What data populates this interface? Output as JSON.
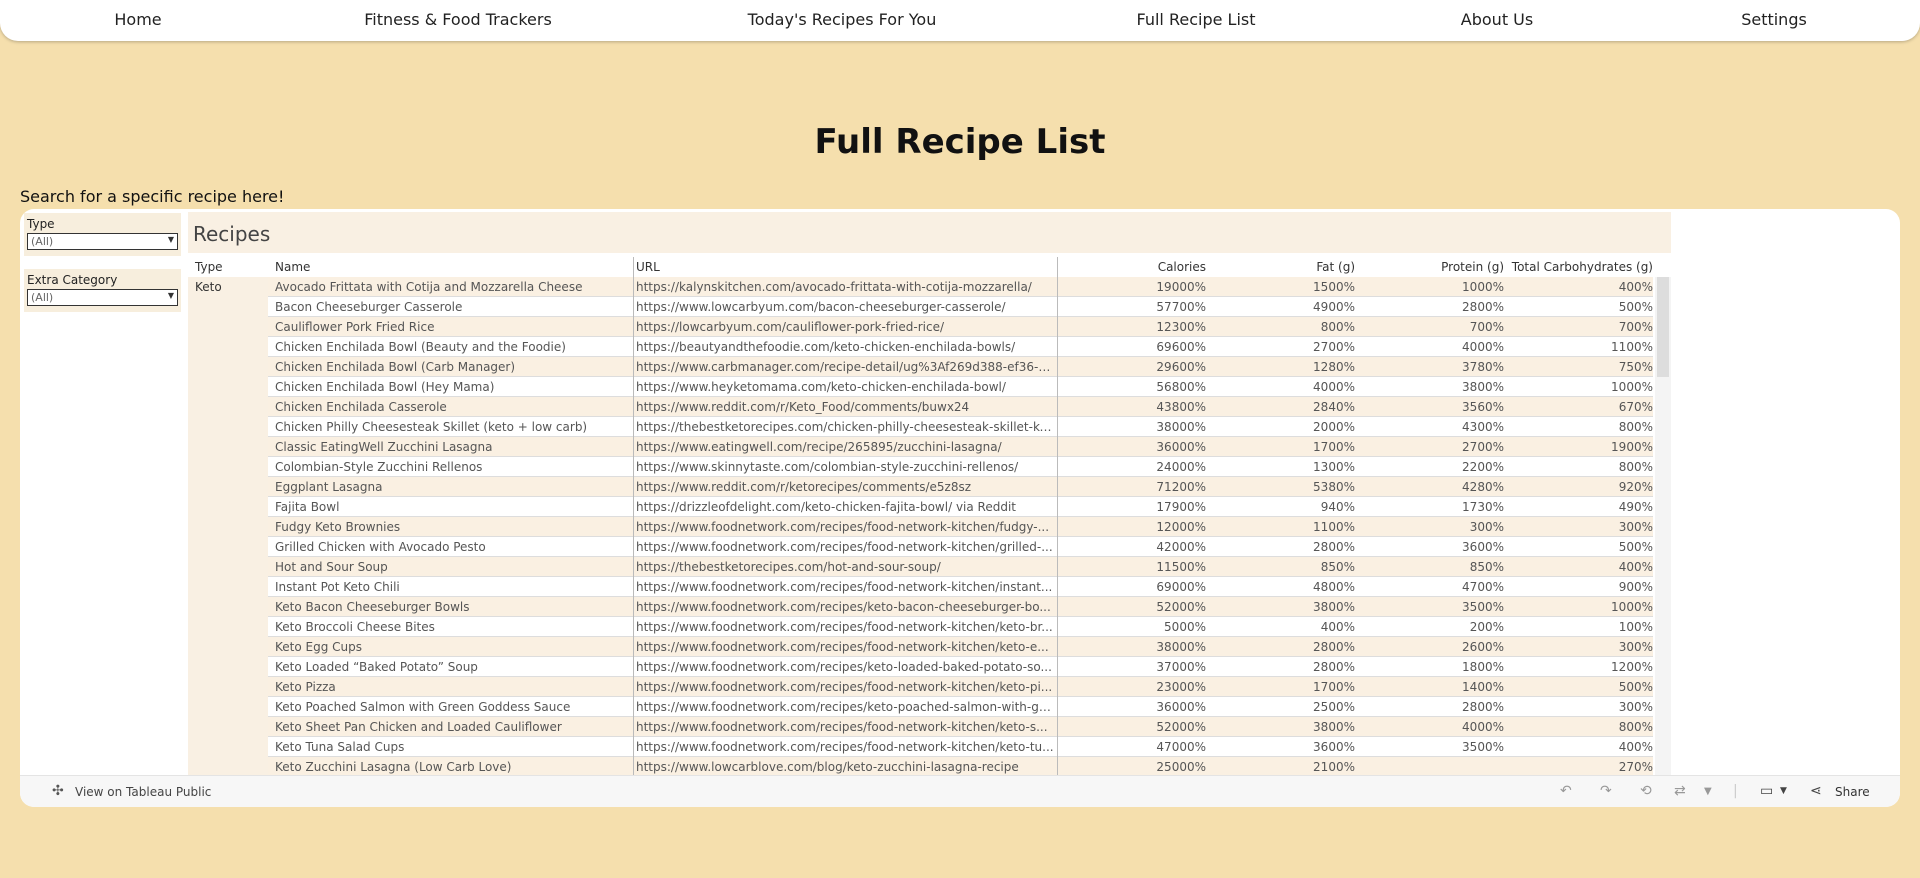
{
  "nav": {
    "items": [
      "Home",
      "Fitness & Food Trackers",
      "Today's Recipes For You",
      "Full Recipe List",
      "About Us",
      "Settings"
    ]
  },
  "page": {
    "title": "Full Recipe List",
    "search_hint": "Search for a specific recipe here!"
  },
  "filters": [
    {
      "label": "Type",
      "value": "(All)"
    },
    {
      "label": "Extra Category",
      "value": "(All)"
    }
  ],
  "sheet": {
    "title": "Recipes",
    "columns": [
      "Type",
      "Name",
      "URL",
      "Calories",
      "Fat (g)",
      "Protein (g)",
      "Total Carbohydrates (g)"
    ],
    "type_value": "Keto",
    "rows": [
      [
        "Avocado Frittata with Cotija and Mozzarella Cheese",
        "https://kalynskitchen.com/avocado-frittata-with-cotija-mozzarella/",
        "19000%",
        "1500%",
        "1000%",
        "400%"
      ],
      [
        "Bacon Cheeseburger Casserole",
        "https://www.lowcarbyum.com/bacon-cheeseburger-casserole/",
        "57700%",
        "4900%",
        "2800%",
        "500%"
      ],
      [
        "Cauliflower Pork Fried Rice",
        "https://lowcarbyum.com/cauliflower-pork-fried-rice/",
        "12300%",
        "800%",
        "700%",
        "700%"
      ],
      [
        "Chicken Enchilada Bowl (Beauty and the Foodie)",
        "https://beautyandthefoodie.com/keto-chicken-enchilada-bowls/",
        "69600%",
        "2700%",
        "4000%",
        "1100%"
      ],
      [
        "Chicken Enchilada Bowl (Carb Manager)",
        "https://www.carbmanager.com/recipe-detail/ug%3Af269d388-ef36-0...",
        "29600%",
        "1280%",
        "3780%",
        "750%"
      ],
      [
        "Chicken Enchilada Bowl (Hey Mama)",
        "https://www.heyketomama.com/keto-chicken-enchilada-bowl/",
        "56800%",
        "4000%",
        "3800%",
        "1000%"
      ],
      [
        "Chicken Enchilada Casserole",
        "https://www.reddit.com/r/Keto_Food/comments/buwx24",
        "43800%",
        "2840%",
        "3560%",
        "670%"
      ],
      [
        "Chicken Philly Cheesesteak Skillet (keto + low carb)",
        "https://thebestketorecipes.com/chicken-philly-cheesesteak-skillet-ke...",
        "38000%",
        "2000%",
        "4300%",
        "800%"
      ],
      [
        "Classic EatingWell Zucchini Lasagna",
        "https://www.eatingwell.com/recipe/265895/zucchini-lasagna/",
        "36000%",
        "1700%",
        "2700%",
        "1900%"
      ],
      [
        "Colombian-Style Zucchini Rellenos",
        "https://www.skinnytaste.com/colombian-style-zucchini-rellenos/",
        "24000%",
        "1300%",
        "2200%",
        "800%"
      ],
      [
        "Eggplant Lasagna",
        "https://www.reddit.com/r/ketorecipes/comments/e5z8sz",
        "71200%",
        "5380%",
        "4280%",
        "920%"
      ],
      [
        "Fajita Bowl",
        "https://drizzleofdelight.com/keto-chicken-fajita-bowl/ via Reddit",
        "17900%",
        "940%",
        "1730%",
        "490%"
      ],
      [
        "Fudgy Keto Brownies",
        "https://www.foodnetwork.com/recipes/food-network-kitchen/fudgy-...",
        "12000%",
        "1100%",
        "300%",
        "300%"
      ],
      [
        "Grilled Chicken with Avocado Pesto",
        "https://www.foodnetwork.com/recipes/food-network-kitchen/grilled-...",
        "42000%",
        "2800%",
        "3600%",
        "500%"
      ],
      [
        "Hot and Sour Soup",
        "https://thebestketorecipes.com/hot-and-sour-soup/",
        "11500%",
        "850%",
        "850%",
        "400%"
      ],
      [
        "Instant Pot Keto Chili",
        "https://www.foodnetwork.com/recipes/food-network-kitchen/instant...",
        "69000%",
        "4800%",
        "4700%",
        "900%"
      ],
      [
        "Keto Bacon Cheeseburger Bowls",
        "https://www.foodnetwork.com/recipes/keto-bacon-cheeseburger-bo...",
        "52000%",
        "3800%",
        "3500%",
        "1000%"
      ],
      [
        "Keto Broccoli Cheese Bites",
        "https://www.foodnetwork.com/recipes/food-network-kitchen/keto-br...",
        "5000%",
        "400%",
        "200%",
        "100%"
      ],
      [
        "Keto Egg Cups",
        "https://www.foodnetwork.com/recipes/food-network-kitchen/keto-e...",
        "38000%",
        "2800%",
        "2600%",
        "300%"
      ],
      [
        "Keto Loaded “Baked Potato” Soup",
        "https://www.foodnetwork.com/recipes/keto-loaded-baked-potato-so...",
        "37000%",
        "2800%",
        "1800%",
        "1200%"
      ],
      [
        "Keto Pizza",
        "https://www.foodnetwork.com/recipes/food-network-kitchen/keto-pi...",
        "23000%",
        "1700%",
        "1400%",
        "500%"
      ],
      [
        "Keto Poached Salmon with Green Goddess Sauce",
        "https://www.foodnetwork.com/recipes/keto-poached-salmon-with-gr...",
        "36000%",
        "2500%",
        "2800%",
        "300%"
      ],
      [
        "Keto Sheet Pan Chicken and Loaded Cauliflower",
        "https://www.foodnetwork.com/recipes/food-network-kitchen/keto-s...",
        "52000%",
        "3800%",
        "4000%",
        "800%"
      ],
      [
        "Keto Tuna Salad Cups",
        "https://www.foodnetwork.com/recipes/food-network-kitchen/keto-tu...",
        "47000%",
        "3600%",
        "3500%",
        "400%"
      ],
      [
        "Keto Zucchini Lasagna (Low Carb Love)",
        "https://www.lowcarblove.com/blog/keto-zucchini-lasagna-recipe",
        "25000%",
        "2100%",
        "",
        "270%"
      ]
    ]
  },
  "toolbar": {
    "view_label": "View on Tableau Public",
    "share_label": "Share"
  }
}
